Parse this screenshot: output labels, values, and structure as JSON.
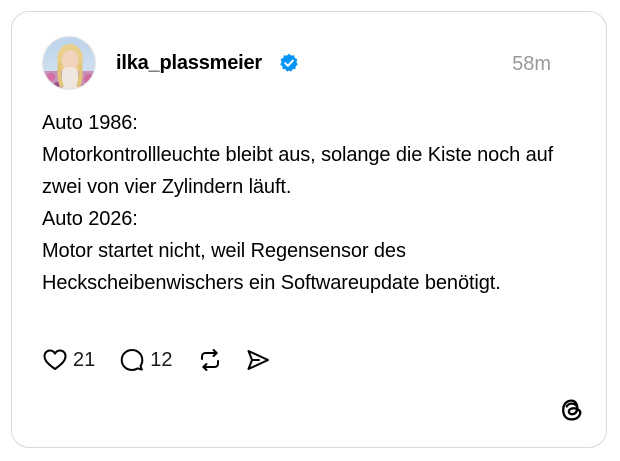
{
  "post": {
    "author": {
      "username": "ilka_plassmeier",
      "verified": true,
      "avatar_icon": "avatar-photo"
    },
    "timestamp": "58m",
    "text": "Auto 1986:\nMotorkontrollleuchte bleibt aus, solange die Kiste noch auf zwei von vier Zylindern läuft.\nAuto 2026:\nMotor startet nicht, weil Regensensor des Heckscheibenwischers ein Softwareupdate benötigt.",
    "actions": {
      "likes": "21",
      "replies": "12",
      "like_icon": "heart-icon",
      "reply_icon": "comment-icon",
      "repost_icon": "repost-icon",
      "share_icon": "send-icon"
    }
  },
  "brand": {
    "logo_icon": "threads-logo-icon"
  },
  "colors": {
    "verified_blue": "#0095f6",
    "timestamp_gray": "#999999",
    "border": "#d9d9d9"
  }
}
